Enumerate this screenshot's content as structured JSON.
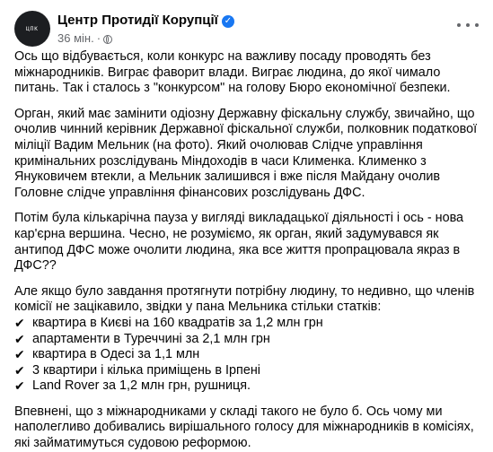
{
  "post": {
    "author": "Центр Протидії Корупції",
    "avatar_text": "ЦПК",
    "time": "36 мін.",
    "separator": "·",
    "paragraphs": [
      "Ось що відбувається, коли конкурс на важливу посаду проводять без міжнародників. Виграє фаворит влади. Виграє людина, до якої чимало питань. Так і сталось з \"конкурсом\" на голову Бюро економічної безпеки.",
      "Орган, який має замінити одіозну Державну фіскальну службу, звичайно, що очолив чинний керівник Державної фіскальної служби, полковник податкової міліції Вадим Мельник (на фото). Який очолював Слідче управління кримінальних розслідувань Міндоходів в часи Клименка. Клименко з Януковичем втекли, а Мельник залишився і вже після Майдану очолив Головне слідче управління фінансових розслідувань ДФС.",
      "Потім була кількарічна пауза у вигляді викладацької діяльності і ось - нова кар'єрна вершина. Чесно, не розуміємо, як орган, який задумувався як антипод ДФС може очолити людина, яка все життя пропрацювала якраз в ДФС??",
      "Але якщо було завдання протягнути потрібну людину, то недивно, що членів комісії не зацікавило, звідки у пана Мельника стільки статків:"
    ],
    "assets": [
      "квартира в Києві на 160 квадратів за 1,2 млн грн",
      "апартаменти в Туреччині за 2,1 млн грн",
      "квартира в Одесі за 1,1 млн",
      "3 квартири і кілька приміщень в Ірпені",
      "Land Rover за 1,2 млн грн, рушниця."
    ],
    "closing": "Впевнені, що з міжнародниками у складі такого не було б. Ось чому ми наполегливо добивались вирішального голосу для міжнародників в комісіях, які займатимуться судовою реформою."
  },
  "colors": {
    "text": "#050505",
    "meta": "#65676b",
    "verified": "#1877f2",
    "avatar": "#1c1e21"
  }
}
